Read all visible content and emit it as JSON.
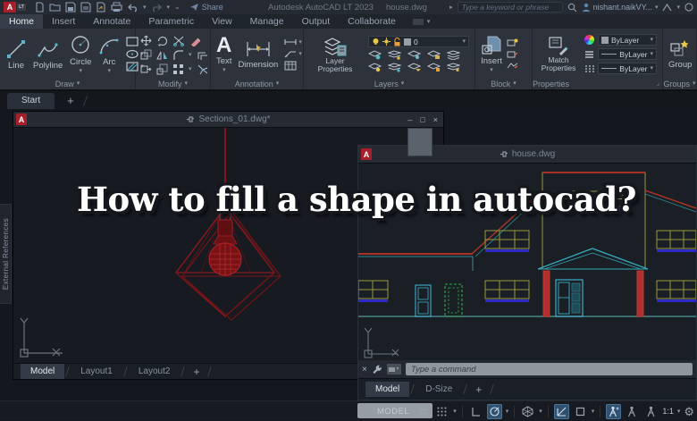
{
  "titlebar": {
    "app_title": "Autodesk AutoCAD LT 2023",
    "doc_title": "house.dwg",
    "share_label": "Share",
    "search_placeholder": "Type a keyword or phrase",
    "user_name": "nishant.naikVY..."
  },
  "ribbon": {
    "tabs": [
      "Home",
      "Insert",
      "Annotate",
      "Parametric",
      "View",
      "Manage",
      "Output",
      "Collaborate"
    ],
    "active_tab": "Home",
    "draw": {
      "label": "Draw",
      "line": "Line",
      "polyline": "Polyline",
      "circle": "Circle",
      "arc": "Arc"
    },
    "modify": {
      "label": "Modify"
    },
    "annotation": {
      "label": "Annotation",
      "text": "Text",
      "dimension": "Dimension"
    },
    "layers": {
      "label": "Layers",
      "layer_properties": "Layer Properties",
      "current_layer": "0"
    },
    "block": {
      "label": "Block",
      "insert": "Insert"
    },
    "properties": {
      "label": "Properties",
      "match_properties": "Match Properties",
      "color": "ByLayer",
      "lineweight": "ByLayer",
      "linetype": "ByLayer"
    },
    "groups": {
      "label": "Groups",
      "group": "Group"
    }
  },
  "file_tabs": {
    "start": "Start"
  },
  "sections_window": {
    "title": "Sections_01.dwg*",
    "tabs": [
      "Model",
      "Layout1",
      "Layout2"
    ],
    "active_tab": "Model"
  },
  "house_window": {
    "title": "house.dwg",
    "tabs": [
      "Model",
      "D-Size"
    ],
    "active_tab": "Model",
    "command_placeholder": "Type a command"
  },
  "left_palette": {
    "label": "External References"
  },
  "overlay": {
    "headline": "How to fill a shape in autocad?"
  },
  "statusbar": {
    "model_label": "MODEL",
    "annotation_scale": "1:1"
  },
  "icons": {
    "dropdown": "▾",
    "caret_right": "▸",
    "plus": "+",
    "close": "×",
    "minimize": "–",
    "maximize": "□",
    "gear": "⚙",
    "text_tool": "A"
  },
  "colors": {
    "logo_red": "#a81e2b",
    "drawing_red": "#8c181c",
    "teal": "#3ab0c8",
    "olive": "#98983d",
    "sill_blue": "#2a2ac8",
    "door_green": "#2fae4a",
    "status_highlight": "#32516f"
  }
}
